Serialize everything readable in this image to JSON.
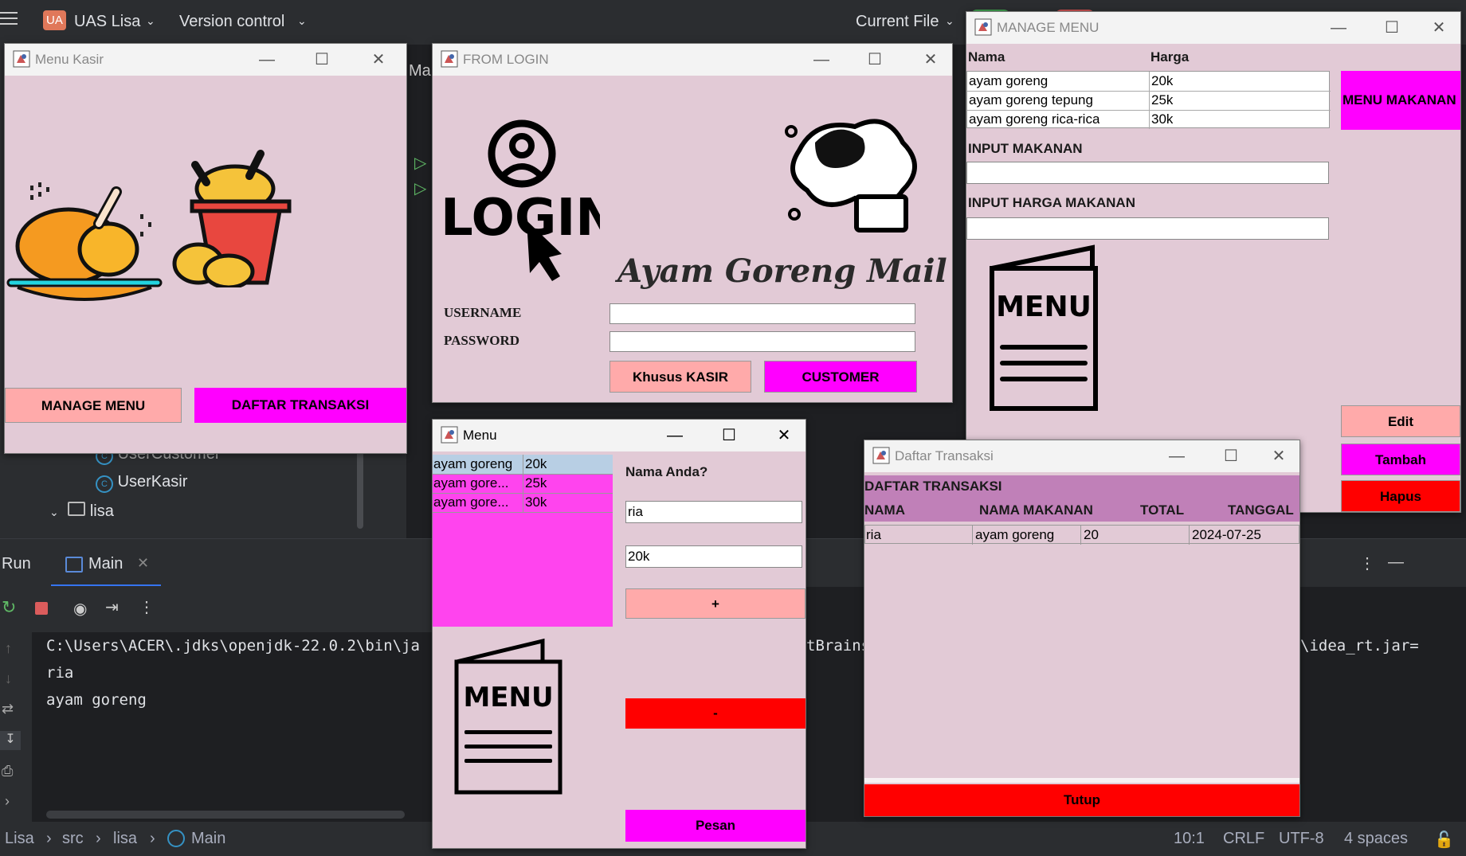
{
  "ide": {
    "project_badge": "UA",
    "project_name": "UAS Lisa",
    "version_control": "Version control",
    "current_file": "Current File",
    "tree_items": [
      "UserCustomer",
      "UserKasir",
      "lisa",
      "Main"
    ],
    "run_tab": "Run",
    "main_tab": "Main",
    "console_lines": [
      "C:\\Users\\ACER\\.jdks\\openjdk-22.0.2\\bin\\ja",
      "ria",
      "ayam goreng"
    ],
    "console_fragment_mid": "tBrains",
    "console_fragment_right": "\\idea_rt.jar=",
    "editor_fragment": "Ma",
    "breadcrumb": [
      "Lisa",
      "src",
      "lisa",
      "Main"
    ],
    "status_position": "10:1",
    "status_line_ending": "CRLF",
    "status_encoding": "UTF-8",
    "status_indent": "4 spaces"
  },
  "menu_kasir": {
    "title": "Menu Kasir",
    "manage_menu_label": "MANAGE MENU",
    "daftar_transaksi_label": "DAFTAR TRANSAKSI"
  },
  "login": {
    "title": "FROM LOGIN",
    "logo_text": "LOGIN",
    "brand": "Ayam Goreng Mail",
    "username_label": "USERNAME",
    "password_label": "PASSWORD",
    "username_value": "",
    "password_value": "",
    "kasir_button": "Khusus KASIR",
    "customer_button": "CUSTOMER"
  },
  "manage_menu": {
    "title": "MANAGE MENU",
    "columns": [
      "Nama",
      "Harga"
    ],
    "rows": [
      {
        "nama": "ayam goreng",
        "harga": "20k"
      },
      {
        "nama": "ayam goreng tepung",
        "harga": "25k"
      },
      {
        "nama": "ayam goreng rica-rica",
        "harga": "30k"
      }
    ],
    "menu_makanan_label": "MENU MAKANAN",
    "input_makanan_label": "INPUT MAKANAN",
    "input_harga_label": "INPUT HARGA MAKANAN",
    "input_makanan_value": "",
    "input_harga_value": "",
    "menu_sign_text": "MENU",
    "edit_label": "Edit",
    "tambah_label": "Tambah",
    "hapus_label": "Hapus"
  },
  "menu": {
    "title": "Menu",
    "rows": [
      {
        "nama": "ayam goreng",
        "harga": "20k"
      },
      {
        "nama": "ayam gore...",
        "harga": "25k"
      },
      {
        "nama": "ayam gore...",
        "harga": "30k"
      }
    ],
    "nama_label": "Nama Anda?",
    "nama_value": "ria",
    "harga_value": "20k",
    "plus_label": "+",
    "minus_label": "-",
    "pesan_label": "Pesan",
    "menu_sign_text": "MENU"
  },
  "transaksi": {
    "title": "Daftar Transaksi",
    "heading": "DAFTAR TRANSAKSI",
    "columns": [
      "NAMA",
      "NAMA MAKANAN",
      "TOTAL",
      "TANGGAL"
    ],
    "rows": [
      {
        "nama": "ria",
        "makanan": "ayam goreng",
        "total": "20",
        "tanggal": "2024-07-25"
      }
    ],
    "tutup_label": "Tutup"
  },
  "colors": {
    "window_bg": "#e2cad6",
    "magenta": "#ff00ff",
    "red": "#ff0000",
    "salmon": "#ffaaaa",
    "pink_list": "#ff44ee",
    "header_purple": "#c080b8"
  }
}
